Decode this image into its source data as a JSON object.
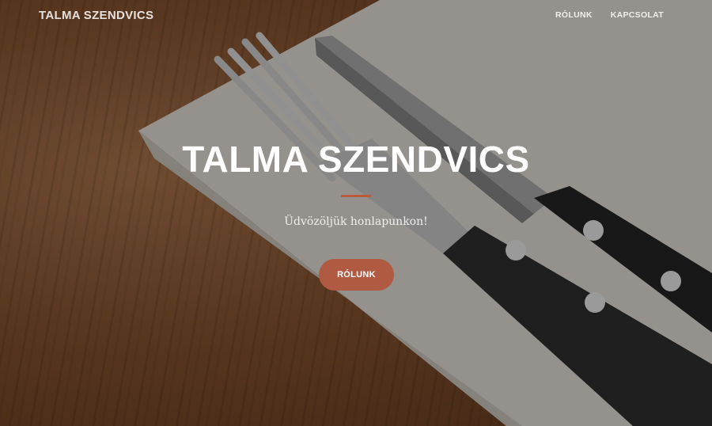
{
  "navbar": {
    "brand": "TALMA SZENDVICS",
    "links": [
      {
        "label": "RÓLUNK"
      },
      {
        "label": "KAPCSOLAT"
      }
    ]
  },
  "header": {
    "title": "TALMA SZENDVICS",
    "subtitle": "Üdvözöljük honlapunkon!",
    "cta_label": "RÓLUNK"
  },
  "colors": {
    "accent": "#b05a41",
    "divider": "#b85b3f",
    "text": "#ffffff"
  },
  "background": {
    "description_icon": "wood-table-napkin-cutlery-photo"
  }
}
